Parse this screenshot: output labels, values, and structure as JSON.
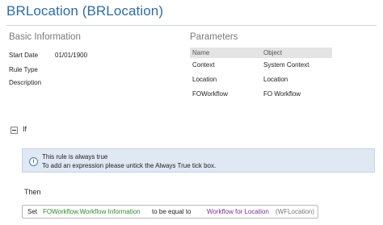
{
  "header": {
    "title": "BRLocation (BRLocation)"
  },
  "basic_info": {
    "heading": "Basic Information",
    "start_date_label": "Start Date",
    "start_date_value": "01/01/1900",
    "rule_type_label": "Rule Type",
    "description_label": "Description"
  },
  "parameters": {
    "heading": "Parameters",
    "columns": [
      "Name",
      "Object"
    ],
    "rows": [
      [
        "Context",
        "System Context"
      ],
      [
        "Location",
        "Location"
      ],
      [
        "FOWorkflow",
        "FO Workflow"
      ]
    ]
  },
  "if_section": {
    "label": "If",
    "info_line1": "This rule is always true",
    "info_line2": "To add an expression please untick the Always True tick box."
  },
  "then_section": {
    "label": "Then",
    "set_word": "Set",
    "target": "FOWorkflow.Workflow Information",
    "operator": "to be equal to",
    "value_name": "Workflow for Location",
    "value_param": "(WFLocation)"
  },
  "colors": {
    "title": "#2e6da4",
    "target": "#2f8a2f",
    "value": "#7a2d9a",
    "info_bg": "#dfe8f3"
  },
  "icons": [
    "collapse-toggle-icon",
    "info-icon"
  ]
}
